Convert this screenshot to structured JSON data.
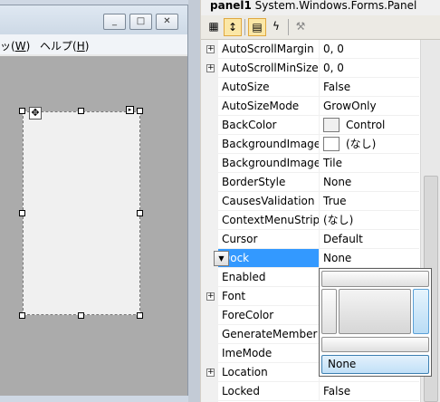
{
  "designer": {
    "window_buttons": [
      "_",
      "□",
      "✕"
    ],
    "menu": [
      {
        "before": "ッ(",
        "mnemonic": "W",
        "after": ")"
      },
      {
        "before": "ヘルプ(",
        "mnemonic": "H",
        "after": ")"
      }
    ]
  },
  "property_grid": {
    "object_name": "panel1",
    "object_type": "System.Windows.Forms.Panel",
    "properties": [
      {
        "name": "AutoScrollMargin",
        "value": "0, 0",
        "expandable": true
      },
      {
        "name": "AutoScrollMinSize",
        "value": "0, 0",
        "expandable": true
      },
      {
        "name": "AutoSize",
        "value": "False"
      },
      {
        "name": "AutoSizeMode",
        "value": "GrowOnly"
      },
      {
        "name": "BackColor",
        "value": "Control",
        "swatch": "#f0f0f0"
      },
      {
        "name": "BackgroundImage",
        "value": "(なし)",
        "swatch": "#ffffff"
      },
      {
        "name": "BackgroundImage",
        "value": "Tile"
      },
      {
        "name": "BorderStyle",
        "value": "None"
      },
      {
        "name": "CausesValidation",
        "value": "True"
      },
      {
        "name": "ContextMenuStrip",
        "value": "(なし)"
      },
      {
        "name": "Cursor",
        "value": "Default"
      },
      {
        "name": "Dock",
        "value": "None",
        "selected": true
      },
      {
        "name": "Enabled",
        "value": ""
      },
      {
        "name": "Font",
        "value": "",
        "expandable": true
      },
      {
        "name": "ForeColor",
        "value": ""
      },
      {
        "name": "GenerateMember",
        "value": ""
      },
      {
        "name": "ImeMode",
        "value": ""
      },
      {
        "name": "Location",
        "value": "",
        "expandable": true
      },
      {
        "name": "Locked",
        "value": "False"
      }
    ]
  },
  "dock_picker": {
    "selected_label": "None",
    "options": [
      "Top",
      "Left",
      "Fill",
      "Right",
      "Bottom",
      "None"
    ]
  },
  "colors": {
    "selection": "#3399ff",
    "form_client": "#ababab",
    "dock_right_highlight": "#b9dcf5"
  }
}
